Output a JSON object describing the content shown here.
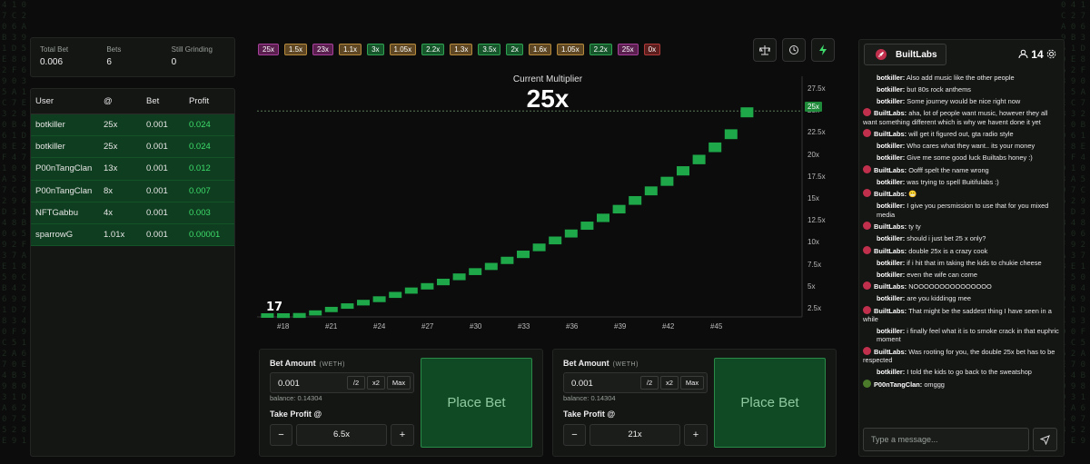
{
  "stats": {
    "total_bet_label": "Total Bet",
    "total_bet_value": "0.006",
    "bets_label": "Bets",
    "bets_value": "6",
    "grinding_label": "Still Grinding",
    "grinding_value": "0"
  },
  "bets_table": {
    "headers": [
      "User",
      "@",
      "Bet",
      "Profit"
    ],
    "rows": [
      {
        "user": "botkiller",
        "at": "25x",
        "bet": "0.001",
        "profit": "0.024"
      },
      {
        "user": "botkiller",
        "at": "25x",
        "bet": "0.001",
        "profit": "0.024"
      },
      {
        "user": "P00nTangClan",
        "at": "13x",
        "bet": "0.001",
        "profit": "0.012"
      },
      {
        "user": "P00nTangClan",
        "at": "8x",
        "bet": "0.001",
        "profit": "0.007"
      },
      {
        "user": "NFTGabbu",
        "at": "4x",
        "bet": "0.001",
        "profit": "0.003"
      },
      {
        "user": "sparrowG",
        "at": "1.01x",
        "bet": "0.001",
        "profit": "0.00001"
      }
    ]
  },
  "history_pills": [
    {
      "label": "25x",
      "color": "purple"
    },
    {
      "label": "1.5x",
      "color": "brown"
    },
    {
      "label": "23x",
      "color": "purple"
    },
    {
      "label": "1.1x",
      "color": "brown"
    },
    {
      "label": "3x",
      "color": "green"
    },
    {
      "label": "1.05x",
      "color": "brown"
    },
    {
      "label": "2.2x",
      "color": "green"
    },
    {
      "label": "1.3x",
      "color": "brown"
    },
    {
      "label": "3.5x",
      "color": "green"
    },
    {
      "label": "2x",
      "color": "green"
    },
    {
      "label": "1.6x",
      "color": "brown"
    },
    {
      "label": "1.05x",
      "color": "brown"
    },
    {
      "label": "2.2x",
      "color": "green"
    },
    {
      "label": "25x",
      "color": "purple"
    },
    {
      "label": "0x",
      "color": "red"
    }
  ],
  "tools": {
    "balance_icon": "scale-icon",
    "history_icon": "history-icon",
    "turbo_icon": "lightning-icon"
  },
  "chart": {
    "title": "Current Multiplier",
    "multiplier": "25x",
    "current_tag": "25x"
  },
  "chart_data": {
    "type": "line",
    "title": "Current Multiplier",
    "x_ticks": [
      "#18",
      "#21",
      "#24",
      "#27",
      "#30",
      "#33",
      "#36",
      "#39",
      "#42",
      "#45"
    ],
    "y_ticks": [
      "27.5x",
      "25x",
      "22.5x",
      "20x",
      "17.5x",
      "15x",
      "12.5x",
      "10x",
      "7.5x",
      "5x",
      "2.5x"
    ],
    "ylim": [
      2.5,
      27.5
    ],
    "series": [
      {
        "x": [
          17,
          18,
          19,
          20,
          21,
          22,
          23,
          24,
          25,
          26,
          27,
          28,
          29,
          30,
          31,
          32,
          33,
          34,
          35,
          36,
          37,
          38,
          39,
          40,
          41,
          42,
          43,
          44,
          45,
          46,
          47
        ],
        "values": [
          1.0,
          1.3,
          1.6,
          1.9,
          2.3,
          2.7,
          3.1,
          3.5,
          4.0,
          4.5,
          5.0,
          5.5,
          6.1,
          6.7,
          7.3,
          8.0,
          8.7,
          9.5,
          10.3,
          11.1,
          12.0,
          12.9,
          13.9,
          14.9,
          16.0,
          17.1,
          18.3,
          19.6,
          21.0,
          22.5,
          25.0
        ]
      }
    ],
    "grid": false,
    "color": "#1fa84a"
  },
  "bet_panels": [
    {
      "amount_label": "Bet Amount",
      "token": "(WETH)",
      "amount": "0.001",
      "half": "/2",
      "double": "x2",
      "max": "Max",
      "balance": "balance: 0.14304",
      "tp_label": "Take Profit @",
      "minus": "−",
      "tp_value": "6.5x",
      "plus": "+",
      "place": "Place Bet"
    },
    {
      "amount_label": "Bet Amount",
      "token": "(WETH)",
      "amount": "0.001",
      "half": "/2",
      "double": "x2",
      "max": "Max",
      "balance": "balance: 0.14304",
      "tp_label": "Take Profit @",
      "minus": "−",
      "tp_value": "21x",
      "plus": "+",
      "place": "Place Bet"
    }
  ],
  "chat": {
    "brand": "BuiltLabs",
    "online": "14",
    "placeholder": "Type a message...",
    "messages": [
      {
        "name": "botkiller:",
        "text": "Also add music like the other people",
        "avatar": false
      },
      {
        "name": "botkiller:",
        "text": "but 80s  rock anthems",
        "avatar": false
      },
      {
        "name": "botkiller:",
        "text": "Some journey would be nice right now",
        "avatar": false
      },
      {
        "name": "BuiltLabs:",
        "text": "aha, lot of people want music, however they all want something different which is why we havent done it yet",
        "avatar": true
      },
      {
        "name": "BuiltLabs:",
        "text": "will get it figured out, gta radio style",
        "avatar": true
      },
      {
        "name": "botkiller:",
        "text": "Who cares what they want.. its your money",
        "avatar": false
      },
      {
        "name": "botkiller:",
        "text": "Give me some good luck Builtabs honey :)",
        "avatar": false
      },
      {
        "name": "BuiltLabs:",
        "text": "Oofff spelt the name wrong",
        "avatar": true
      },
      {
        "name": "botkiller:",
        "text": "was trying to spell Buitifulabs :)",
        "avatar": false
      },
      {
        "name": "BuiltLabs:",
        "text": "😬",
        "avatar": true
      },
      {
        "name": "botkiller:",
        "text": "I give you persmission to use that for you mixed media",
        "avatar": false
      },
      {
        "name": "BuiltLabs:",
        "text": "ty ty",
        "avatar": true
      },
      {
        "name": "botkiller:",
        "text": "should i just bet 25 x only?",
        "avatar": false
      },
      {
        "name": "BuiltLabs:",
        "text": "double 25x is a crazy cook",
        "avatar": true
      },
      {
        "name": "botkiller:",
        "text": "if i hit that im taking the kids to chukie cheese",
        "avatar": false
      },
      {
        "name": "botkiller:",
        "text": "even the wife can come",
        "avatar": false
      },
      {
        "name": "BuiltLabs:",
        "text": "NOOOOOOOOOOOOOOO",
        "avatar": true
      },
      {
        "name": "botkiller:",
        "text": "are you kiddingg mee",
        "avatar": false
      },
      {
        "name": "BuiltLabs:",
        "text": "That might be the saddest thing I have seen in a while",
        "avatar": true
      },
      {
        "name": "botkiller:",
        "text": "i finally feel what it is to smoke crack in that euphric moment",
        "avatar": false
      },
      {
        "name": "BuiltLabs:",
        "text": "Was rooting for you, the double 25x bet has to be respected",
        "avatar": true
      },
      {
        "name": "botkiller:",
        "text": "I told the kids to go back to the sweatshop",
        "avatar": false
      },
      {
        "name": "P00nTangClan:",
        "text": "omggg",
        "avatar": true,
        "green": true
      }
    ]
  }
}
